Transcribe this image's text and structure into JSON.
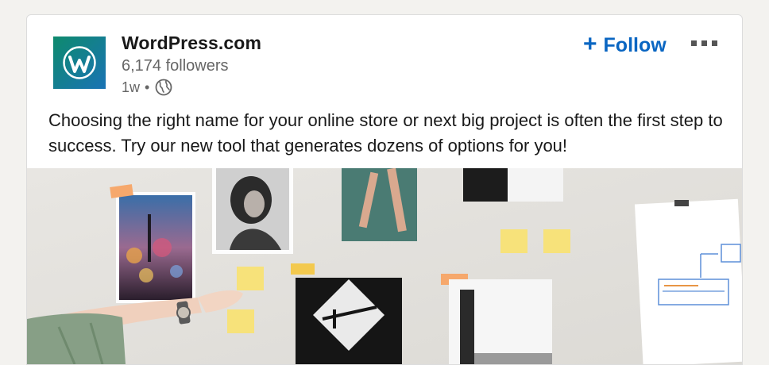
{
  "post": {
    "company_name": "WordPress.com",
    "followers": "6,174 followers",
    "time": "1w",
    "separator": "•",
    "follow_label": "Follow",
    "follow_plus": "+",
    "text": "Choosing the right name for your online store or next big project is often the first step to success. Try our new tool that generates dozens of options for you!"
  },
  "icons": {
    "logo": "wordpress-logo",
    "visibility": "globe-icon",
    "more": "more-icon"
  },
  "colors": {
    "accent": "#0a66c2",
    "logo_green": "#0e8a6d",
    "logo_blue": "#1a73b5"
  }
}
